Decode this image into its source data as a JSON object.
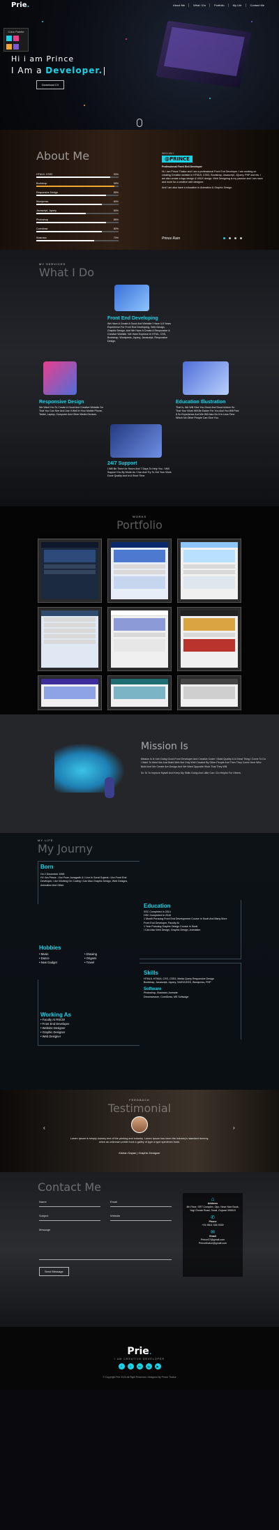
{
  "nav": {
    "logo": "Prie",
    "logo_dot": ".",
    "links": [
      "About Me",
      "What I Do",
      "Portfolio",
      "My Life",
      "Contact Me"
    ]
  },
  "palette": {
    "title": "Color Palette",
    "colors": [
      "#19d3e6",
      "#e83e8c",
      "#f0a833",
      "#7a5bd1"
    ]
  },
  "hero": {
    "line1": "Hi i am Prince",
    "line2_prefix": "I Am a ",
    "line2_highlight": "Developer.",
    "download_label": "Download CV"
  },
  "about": {
    "title": "About Me",
    "skills": [
      {
        "name": "HTML5, CSS3",
        "pct": "90%",
        "level": 0.9
      },
      {
        "name": "Bootstrap",
        "pct": "95%",
        "level": 0.95
      },
      {
        "name": "Responsive Design",
        "pct": "85%",
        "level": 0.85
      },
      {
        "name": "Wordpress",
        "pct": "80%",
        "level": 0.8
      },
      {
        "name": "Javascript, Jquery",
        "pct": "60%",
        "level": 0.6
      },
      {
        "name": "Photoshop",
        "pct": "85%",
        "level": 0.85
      },
      {
        "name": "Coreldraw",
        "pct": "80%",
        "level": 0.8
      },
      {
        "name": "Illustrator",
        "pct": "70%",
        "level": 0.7
      }
    ],
    "who_label": "WHO AM I",
    "name_tag": "@PRINCE",
    "role": "Professional Front End Developer",
    "bio1": "Hi, I am Prince Thakur and I am a professional Front End Developer. I am working on creating Creative website in HTML5, CSS3, Bootstrap, Javascript, JQuery, PHP and etc. I am also create a logo design & UI/UX design. Web Designing is my passion and I am more and more for a creative web designer.",
    "bio2": "And I am also have a education in Animation & Graphic Design.",
    "signature": "Prince Ram"
  },
  "services": {
    "small": "MY SERVICES",
    "big": "What I Do",
    "items": [
      {
        "title": "Front End Developing",
        "desc": "We Have A Create A Good And Website I Have 4-5 Years Experience For Front End Developing, Web Design, Graphic Design, And We Have A Create A Responsive & Creative Website. We Have Expriece In HTML, CSS, Bootstrap, Wordpress, Jquery, Javascript, Responsive Design."
      },
      {
        "title": "Responsive Design",
        "desc": "We Want You To Create A Good And Creative Website So That You Can See And Use It Well In Your Mobile Phone, Tablet, Laptop, Computer And Other Media Devices."
      },
      {
        "title": "Education Illustration",
        "desc": "That Is, We Will Give You Good And Good Advice So That Your Work Will Be Easier For You And You Will Find It So Experience And We Will Also Do It In Less Time Which No Other People Can Give You."
      },
      {
        "title": "24/7 Support",
        "desc": "I Will Be There for Hours And 7 Days To Help You. I Will Support You By Mode As I Can And Try To Get Your Work Done Quality And In A Short Time."
      }
    ]
  },
  "portfolio": {
    "small": "WORKS",
    "big": "Portfolio"
  },
  "mission": {
    "title": "Mission Is",
    "p1": "Mission Is It I Am Doing Good Front Developer And Creative Coder I Build Quality & A Great Thing I Come To Do I Want To Meet Not Just Build Web Not Only Well Created By Other People And Then They Come Here Who Build And We Create Are Design And We Want Opposite Work That They Will.",
    "p2": "So To To Improve Myself And Keep My Skills Going And Little Can I Do Helpful For Others."
  },
  "journey": {
    "small": "MY LIFE",
    "big": "My Journy",
    "born_title": "Born",
    "born_text": "On 2 December 1998\nHi I Am Prince. I Am From Junagadh & I Live In Surat Gujarat. I Am Front End Developer, I Am Working On Coding I Can Also Graphic Design, Web Designs, Animation And Other.",
    "education_title": "Education",
    "education_text": "SSC Completed In 2014\nHSC Completed In 2016\n1 Month Pursuing Front End Development Course In Surat And Many More\nFront End Developer, Faculty At\n1 Year Pursuing Graphic Design Course In Surat\nI Can Also Web Design, Graphic Design, Animation",
    "hobbies_title": "Hobbies",
    "hobbies": [
      "Music",
      "Drawing",
      "Dance",
      "Origami",
      "New Gadget",
      "Travel"
    ],
    "skills_title": "Skills",
    "skills_text": "HTML5, HTML5, CSS, CSS3, Media Query Responsive Design\nBootstrap, Javascript, Jquery, SASS/LESS, Wordpress, PHP",
    "software_title": "Software",
    "software_text": "Photoshop, Illustrator, Animate\nDreamweaver, CorelDraw, MS Softwage",
    "working_title": "Working As",
    "working": [
      "Faculty At RSCW",
      "Front End Developer",
      "Website Designer",
      "Graphic Designer",
      "Web Designer"
    ]
  },
  "testimonial": {
    "small": "FEEDBACK",
    "big": "Testimonial",
    "quote": "Lorem Ipsum is simply dummy text of the printing and industry. Lorem Ipsum has been the industry's standard dummy, when an unknown printer took a galley of type a type specimen book.",
    "author": "Kishan Sapan",
    "author_role": "Graphic Designer"
  },
  "contact": {
    "big": "Contact Me",
    "fields": {
      "name": "Name",
      "email": "Email",
      "subject": "Subject",
      "website": "Website",
      "message": "Message"
    },
    "send_label": "Send Message",
    "address_label": "Address",
    "address": "4th Floor, SRT Complex, Opp. Near Nice Book, Yogi Chowk Road, Surat, Gujarat 395010",
    "phone_label": "Phone",
    "phone": "+91 9601 336 9339",
    "email_label": "Email",
    "email1": "Prince37@gmail.com",
    "email2": "Princethakur@gmail.com"
  },
  "footer": {
    "logo": "Prie",
    "logo_dot": ".",
    "tagline": "I AM CREATIVE DEVELOPER",
    "social": [
      "f",
      "t",
      "in",
      "ig",
      "▶"
    ],
    "copyright": "© Copyright Prie 2020 All Right Reserved. Designed By Prince Thakur"
  }
}
